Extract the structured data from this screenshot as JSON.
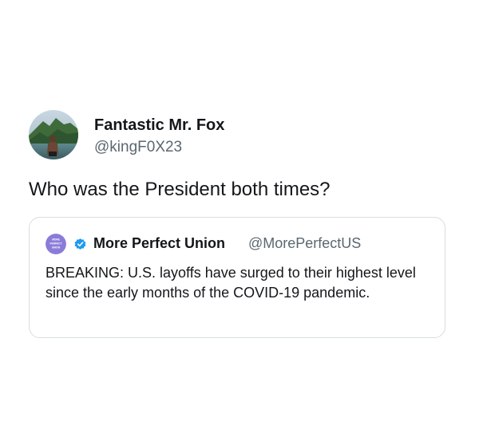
{
  "tweet": {
    "author": {
      "display_name": "Fantastic Mr. Fox",
      "handle": "@kingF0X23"
    },
    "text": "Who was the President both times?",
    "quoted_tweet": {
      "author": {
        "display_name": "More Perfect Union",
        "handle": "@MorePerfectUS",
        "verified": true,
        "avatar_text": "MORE PERFECT UNION"
      },
      "text": "BREAKING: U.S. layoffs have surged to their highest level since the early months of the COVID-19 pandemic."
    }
  },
  "colors": {
    "text_primary": "#14171a",
    "text_secondary": "#5b6770",
    "card_border": "#d7dde2",
    "verified_blue": "#1d9bf0",
    "mpu_purple": "#8b7bd9"
  }
}
